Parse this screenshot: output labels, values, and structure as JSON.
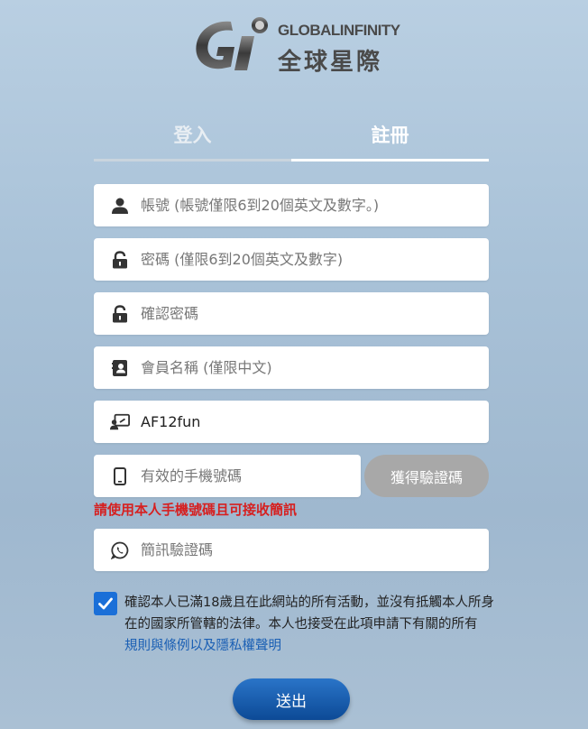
{
  "brand": {
    "name_en": "GLOBALINFINITY",
    "name_zh": "全球星際"
  },
  "tabs": [
    {
      "label": "登入",
      "active": false
    },
    {
      "label": "註冊",
      "active": true
    }
  ],
  "form": {
    "account_placeholder": "帳號 (帳號僅限6到20個英文及數字。)",
    "password_placeholder": "密碼 (僅限6到20個英文及數字)",
    "confirm_password_placeholder": "確認密碼",
    "member_name_placeholder": "會員名稱 (僅限中文)",
    "referral_value": "AF12fun",
    "phone_placeholder": "有效的手機號碼",
    "otp_button_label": "獲得驗證碼",
    "phone_warning": "請使用本人手機號碼且可接收簡訊",
    "sms_code_placeholder": "簡訊驗證碼",
    "agree_checked": true,
    "agree_text": "確認本人已滿18歲且在此網站的所有活動，並沒有抵觸本人所身在的國家所管轄的法律。本人也接受在此項申請下有關的所有 ",
    "agree_link": "規則與條例以及隱私權聲明",
    "submit_label": "送出"
  },
  "colors": {
    "accent": "#1a6fd8",
    "warning": "#d62020",
    "link": "#1a5fb4",
    "otp_button": "#a8a8a8"
  }
}
